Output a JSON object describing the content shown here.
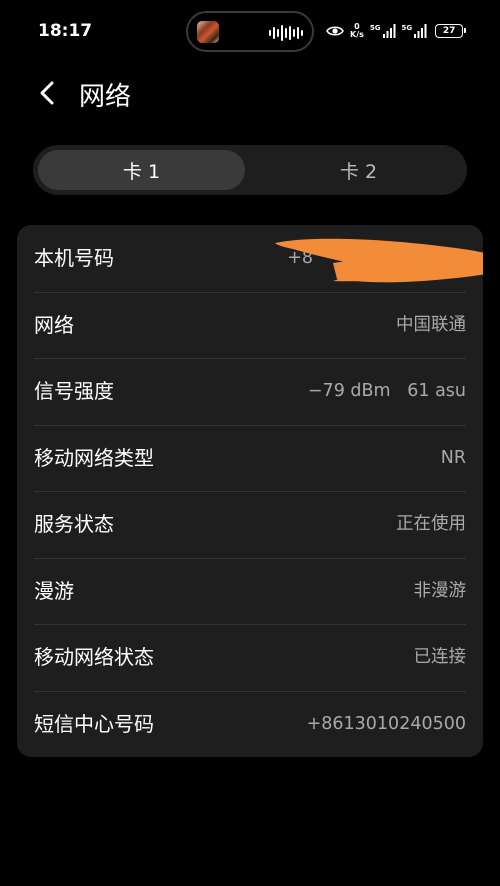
{
  "status_bar": {
    "time": "18:17",
    "net_speed_value": "0",
    "net_speed_unit": "K/s",
    "sim1_type": "5G",
    "sim2_type": "5G",
    "battery": "27"
  },
  "header": {
    "title": "网络"
  },
  "tabs": [
    {
      "label": "卡 1"
    },
    {
      "label": "卡 2"
    }
  ],
  "rows": [
    {
      "label": "本机号码",
      "value": "+8"
    },
    {
      "label": "网络",
      "value": "中国联通"
    },
    {
      "label": "信号强度",
      "value": "−79 dBm   61 asu"
    },
    {
      "label": "移动网络类型",
      "value": "NR"
    },
    {
      "label": "服务状态",
      "value": "正在使用"
    },
    {
      "label": "漫游",
      "value": "非漫游"
    },
    {
      "label": "移动网络状态",
      "value": "已连接"
    },
    {
      "label": "短信中心号码",
      "value": "+8613010240500"
    }
  ],
  "colors": {
    "background": "#000000",
    "card": "#1e1e1e",
    "active_tab": "#3a3a3a",
    "redaction": "#f28c38"
  }
}
